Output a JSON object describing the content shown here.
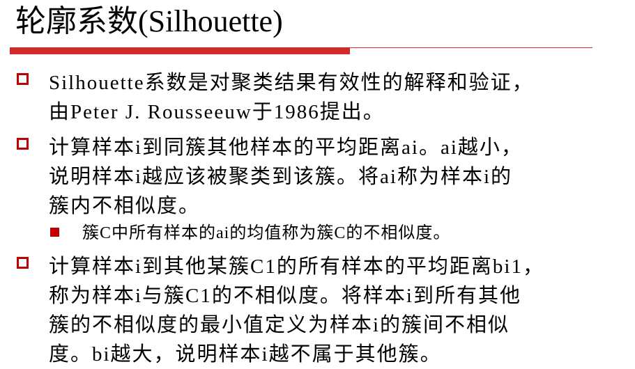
{
  "slide": {
    "title": "轮廓系数(Silhouette)",
    "bullets": [
      {
        "lines": [
          "Silhouette系数是对聚类结果有效性的解释和验证，",
          "由Peter J. Rousseeuw于1986提出。"
        ]
      },
      {
        "lines": [
          "计算样本i到同簇其他样本的平均距离ai。ai越小，",
          "说明样本i越应该被聚类到该簇。将ai称为样本i的",
          "簇内不相似度。"
        ]
      },
      {
        "lines": [
          "计算样本i到其他某簇C1的所有样本的平均距离bi1，",
          "称为样本i与簇C1的不相似度。将样本i到所有其他",
          "簇的不相似度的最小值定义为样本i的簇间不相似",
          "度。bi越大，说明样本i越不属于其他簇。"
        ]
      }
    ],
    "sub_bullet": "簇C中所有样本的ai的均值称为簇C的不相似度。"
  },
  "colors": {
    "accent": "#c00000",
    "rule": "#d12a2a"
  },
  "icons": {
    "bullet": "hollow-square-icon",
    "sub_bullet": "filled-square-icon"
  }
}
